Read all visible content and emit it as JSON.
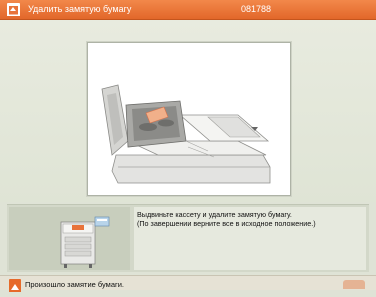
{
  "header": {
    "title": "Удалить замятую бумагу",
    "code": "081788",
    "icon": "jam-alert-icon",
    "color": "#e8733a"
  },
  "illustration": {
    "icon": "paper-jam-feeder-illustration"
  },
  "instructions": {
    "thumbnail_icon": "printer-device-icon",
    "line1": "Выдвиньте кассету и удалите замятую бумагу.",
    "line2": "(По завершении верните все в исходное положение.)"
  },
  "status": {
    "message": "Произошло замятие бумаги.",
    "icon": "alert-icon"
  }
}
